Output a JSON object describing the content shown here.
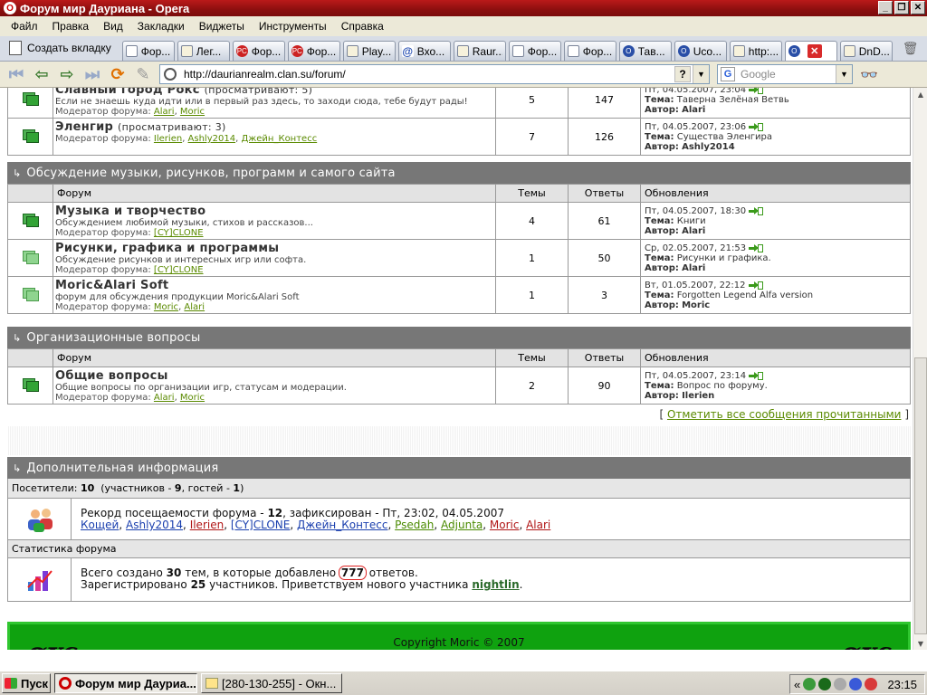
{
  "window": {
    "title": "Форум мир Дауриана - Opera"
  },
  "menu": [
    "Файл",
    "Правка",
    "Вид",
    "Закладки",
    "Виджеты",
    "Инструменты",
    "Справка"
  ],
  "tabs": {
    "new_tab": "Создать вкладку",
    "items": [
      {
        "label": "Фор...",
        "icon": "blank"
      },
      {
        "label": "Лег...",
        "icon": "doc"
      },
      {
        "label": "Фор...",
        "icon": "pc"
      },
      {
        "label": "Фор...",
        "icon": "pc"
      },
      {
        "label": "Play...",
        "icon": "doc"
      },
      {
        "label": "Вхо...",
        "icon": "at"
      },
      {
        "label": "Raur...",
        "icon": "doc"
      },
      {
        "label": "Фор...",
        "icon": "blank"
      },
      {
        "label": "Фор...",
        "icon": "blank"
      },
      {
        "label": "Тав...",
        "icon": "op"
      },
      {
        "label": "Uco...",
        "icon": "op"
      },
      {
        "label": "http:...",
        "icon": "doc"
      },
      {
        "label": "",
        "icon": "op",
        "active": true
      },
      {
        "label": "DnD...",
        "icon": "doc"
      }
    ]
  },
  "address": {
    "url": "http://daurianrealm.clan.su/forum/",
    "search_placeholder": "Google",
    "help": "?"
  },
  "columns": {
    "forum": "Форум",
    "topics": "Темы",
    "answers": "Ответы",
    "updates": "Обновления"
  },
  "labels": {
    "moderator": "Модератор форума:",
    "topic": "Тема:",
    "author": "Автор:"
  },
  "top_rows": [
    {
      "name": "Славный город Рокс",
      "viewing": "(просматривают: 5)",
      "desc": "Если не знаешь куда идти или в первый раз здесь, то заходи сюда, тебе будут рады!",
      "mods": [
        "Alari",
        "Moric"
      ],
      "topics": "5",
      "answers": "147",
      "date": "Пт, 04.05.2007, 23:04",
      "topic": "Таверна Зелёная Ветвь",
      "author": "Alari"
    },
    {
      "name": "Эленгир",
      "viewing": "(просматривают: 3)",
      "desc": "",
      "mods": [
        "Ilerien",
        "Ashly2014",
        "Джейн_Контесс"
      ],
      "topics": "7",
      "answers": "126",
      "date": "Пт, 04.05.2007, 23:06",
      "topic": "Существа Эленгира",
      "author": "Ashly2014"
    }
  ],
  "sec_music": {
    "title": "Обсуждение музыки, рисунков, программ и самого сайта",
    "rows": [
      {
        "name": "Музыка и творчество",
        "desc": "Обсуждением любимой музыки, стихов и рассказов...",
        "mods": [
          "[CY]CLONE"
        ],
        "topics": "4",
        "answers": "61",
        "date": "Пт, 04.05.2007, 18:30",
        "topic": "Книги",
        "author": "Alari"
      },
      {
        "name": "Рисунки, графика и программы",
        "desc": "Обсуждение рисунков и интересных игр или софта.",
        "mods": [
          "[CY]CLONE"
        ],
        "topics": "1",
        "answers": "50",
        "date": "Ср, 02.05.2007, 21:53",
        "topic": "Рисунки и графика.",
        "author": "Alari"
      },
      {
        "name": "Moric&Alari Soft",
        "desc": "форум для обсуждения продукции Moric&Alari Soft",
        "mods": [
          "Moric",
          "Alari"
        ],
        "topics": "1",
        "answers": "3",
        "date": "Вт, 01.05.2007, 22:12",
        "topic": "Forgotten Legend Alfa version",
        "author": "Moric"
      }
    ]
  },
  "sec_org": {
    "title": "Организационные вопросы",
    "rows": [
      {
        "name": "Общие вопросы",
        "desc": "Общие вопросы по организации игр, статусам и модерации.",
        "mods": [
          "Alari",
          "Moric"
        ],
        "topics": "2",
        "answers": "90",
        "date": "Пт, 04.05.2007, 23:14",
        "topic": "Вопрос по форуму.",
        "author": "Ilerien"
      }
    ]
  },
  "mark_all": {
    "open": "[",
    "link": "Отметить все сообщения прочитанными",
    "close": "]"
  },
  "info": {
    "title": "Дополнительная информация",
    "visitors_label": "Посетители:",
    "visitors": "10",
    "members_part": "(участников -",
    "members": "9",
    "guests_part": ", гостей -",
    "guests": "1",
    "close": ")",
    "record_text": "Рекорд посещаемости форума -",
    "record_num": "12",
    "record_rest": ", зафиксирован - Пт, 23:02, 04.05.2007",
    "users": [
      {
        "n": "Кощей",
        "c": "blue"
      },
      {
        "n": "Ashly2014",
        "c": "blue"
      },
      {
        "n": "Ilerien",
        "c": "red"
      },
      {
        "n": "[CY]CLONE",
        "c": "blue"
      },
      {
        "n": "Джейн_Контесс",
        "c": "blue"
      },
      {
        "n": "Psedah",
        "c": "grn"
      },
      {
        "n": "Adjunta",
        "c": "grn"
      },
      {
        "n": "Moric",
        "c": "red"
      },
      {
        "n": "Alari",
        "c": "red"
      }
    ],
    "stats_label": "Статистика форума",
    "s1a": "Всего создано",
    "s1b": "30",
    "s1c": "тем, в которые добавлено",
    "s1d": "777",
    "s1e": "ответов.",
    "s2a": "Зарегистрировано",
    "s2b": "25",
    "s2c": "участников. Приветствуем нового участника",
    "s2d": "nightlin",
    "s2e": "."
  },
  "footer": {
    "copyright": "Copyright Moric © 2007",
    "logo": "ɑʏc"
  },
  "taskbar": {
    "start": "Пуск",
    "btn1": "Форум мир Дауриа...",
    "btn2": "[280-130-255] - Окн...",
    "clock": "23:15"
  }
}
